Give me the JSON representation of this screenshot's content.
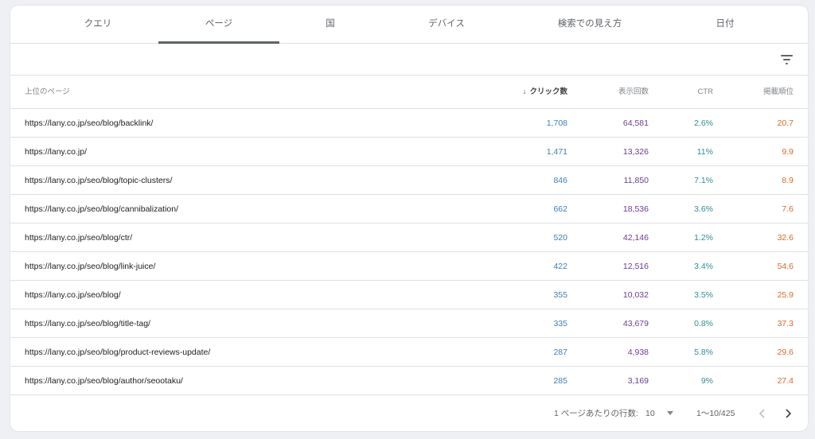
{
  "tabs": [
    {
      "label": "クエリ",
      "active": false
    },
    {
      "label": "ページ",
      "active": true
    },
    {
      "label": "国",
      "active": false
    },
    {
      "label": "デバイス",
      "active": false
    },
    {
      "label": "検索での見え方",
      "active": false
    },
    {
      "label": "日付",
      "active": false
    }
  ],
  "toolbar": {
    "filter_icon": "filter-list-icon"
  },
  "table": {
    "headers": {
      "page": "上位のページ",
      "clicks": "クリック数",
      "impressions": "表示回数",
      "ctr": "CTR",
      "position": "掲載順位"
    },
    "sort_indicator": "↓",
    "rows": [
      {
        "page": "https://lany.co.jp/seo/blog/backlink/",
        "clicks": "1,708",
        "impressions": "64,581",
        "ctr": "2.6%",
        "position": "20.7"
      },
      {
        "page": "https://lany.co.jp/",
        "clicks": "1,471",
        "impressions": "13,326",
        "ctr": "11%",
        "position": "9.9"
      },
      {
        "page": "https://lany.co.jp/seo/blog/topic-clusters/",
        "clicks": "846",
        "impressions": "11,850",
        "ctr": "7.1%",
        "position": "8.9"
      },
      {
        "page": "https://lany.co.jp/seo/blog/cannibalization/",
        "clicks": "662",
        "impressions": "18,536",
        "ctr": "3.6%",
        "position": "7.6"
      },
      {
        "page": "https://lany.co.jp/seo/blog/ctr/",
        "clicks": "520",
        "impressions": "42,146",
        "ctr": "1.2%",
        "position": "32.6"
      },
      {
        "page": "https://lany.co.jp/seo/blog/link-juice/",
        "clicks": "422",
        "impressions": "12,516",
        "ctr": "3.4%",
        "position": "54.6"
      },
      {
        "page": "https://lany.co.jp/seo/blog/",
        "clicks": "355",
        "impressions": "10,032",
        "ctr": "3.5%",
        "position": "25.9"
      },
      {
        "page": "https://lany.co.jp/seo/blog/title-tag/",
        "clicks": "335",
        "impressions": "43,679",
        "ctr": "0.8%",
        "position": "37.3"
      },
      {
        "page": "https://lany.co.jp/seo/blog/product-reviews-update/",
        "clicks": "287",
        "impressions": "4,938",
        "ctr": "5.8%",
        "position": "29.6"
      },
      {
        "page": "https://lany.co.jp/seo/blog/author/seootaku/",
        "clicks": "285",
        "impressions": "3,169",
        "ctr": "9%",
        "position": "27.4"
      }
    ]
  },
  "footer": {
    "rows_per_page_label": "1 ページあたりの行数:",
    "rows_per_page_value": "10",
    "range": "1〜10/425"
  },
  "colors": {
    "clicks": "#3e7fb5",
    "impressions": "#6c3d8f",
    "ctr": "#2e8f95",
    "position": "#d9682a"
  }
}
